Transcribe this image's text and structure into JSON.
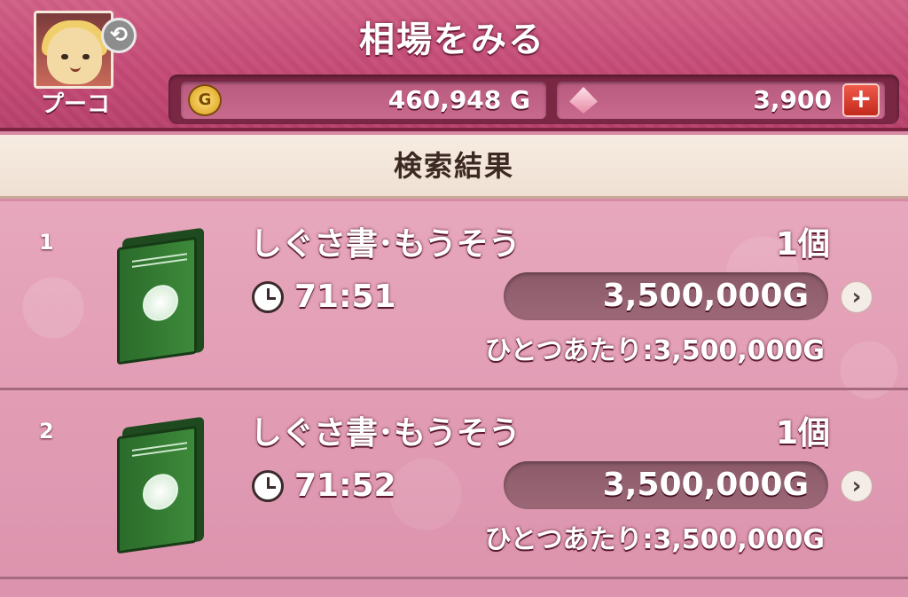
{
  "header": {
    "title": "相場をみる",
    "player_name": "プーコ",
    "gold_amount": "460,948 G",
    "gem_amount": "3,900",
    "coin_symbol": "G",
    "swap_symbol": "⟲",
    "plus_symbol": "+"
  },
  "section": {
    "title": "検索結果"
  },
  "results": [
    {
      "index": "1",
      "name": "しぐさ書･もうそう",
      "quantity": "1個",
      "time_left": "71:51",
      "total_price": "3,500,000G",
      "unit_price": "ひとつあたり:3,500,000G",
      "arrow": "›"
    },
    {
      "index": "2",
      "name": "しぐさ書･もうそう",
      "quantity": "1個",
      "time_left": "71:52",
      "total_price": "3,500,000G",
      "unit_price": "ひとつあたり:3,500,000G",
      "arrow": "›"
    }
  ],
  "icons": {
    "avatar": "character-portrait-icon",
    "swap": "swap-character-icon",
    "coin": "gold-coin-icon",
    "gem": "gem-icon",
    "plus": "plus-icon",
    "book": "green-book-icon",
    "clock": "clock-icon",
    "arrow": "chevron-right-icon"
  },
  "colors": {
    "header": "#c44a75",
    "list_bg": "#e7a7bc",
    "section_bar": "#f7ece2",
    "plus_button": "#d73a2c",
    "book": "#3d8a3a"
  }
}
